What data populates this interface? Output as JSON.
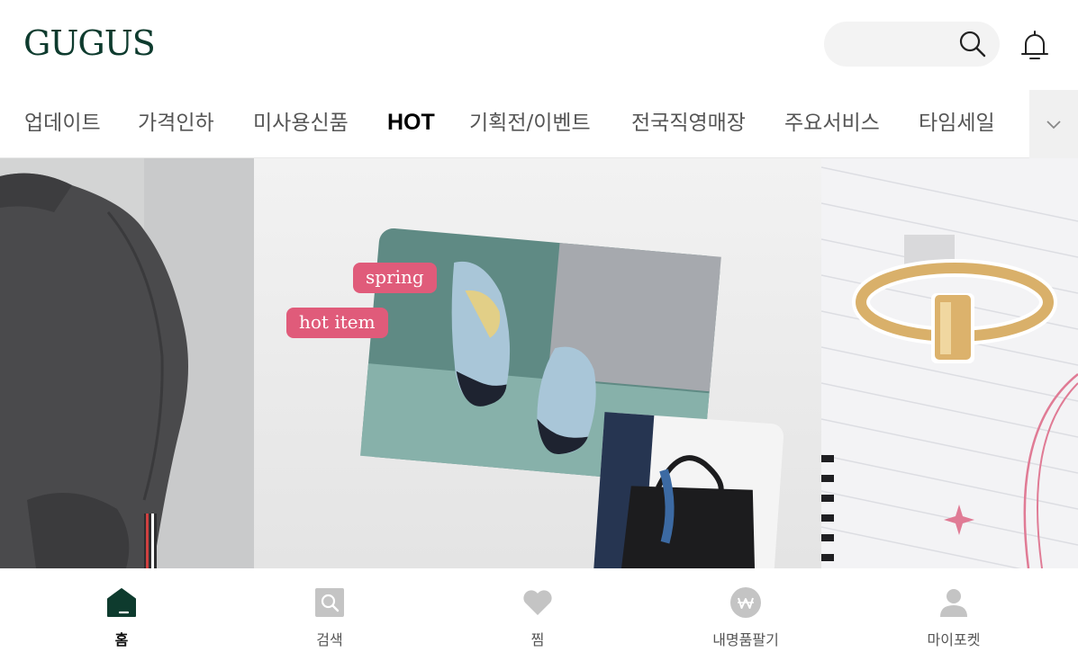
{
  "header": {
    "logo": "GUGUS",
    "search": {
      "placeholder": "",
      "icon": "search-icon"
    },
    "notification": {
      "icon": "bell-icon"
    }
  },
  "tabs": {
    "items": [
      {
        "label": "업데이트"
      },
      {
        "label": "가격인하"
      },
      {
        "label": "미사용신품"
      },
      {
        "label": "HOT"
      },
      {
        "label": "기획전/이벤트"
      },
      {
        "label": "전국직영매장"
      },
      {
        "label": "주요서비스"
      },
      {
        "label": "타임세일"
      }
    ],
    "active": "HOT",
    "more_icon": "chevron-down-icon"
  },
  "banner": {
    "center_tags": [
      "spring",
      "hot item"
    ]
  },
  "bottom_nav": {
    "items": [
      {
        "label": "홈",
        "icon": "home-icon",
        "active": true
      },
      {
        "label": "검색",
        "icon": "search-icon",
        "active": false
      },
      {
        "label": "찜",
        "icon": "heart-icon",
        "active": false
      },
      {
        "label": "내명품팔기",
        "icon": "won-coin-icon",
        "active": false
      },
      {
        "label": "마이포켓",
        "icon": "user-icon",
        "active": false
      }
    ]
  },
  "colors": {
    "brand": "#0e3b2e",
    "tag": "#e05b7a",
    "nav_inactive": "#c4c4c4"
  }
}
